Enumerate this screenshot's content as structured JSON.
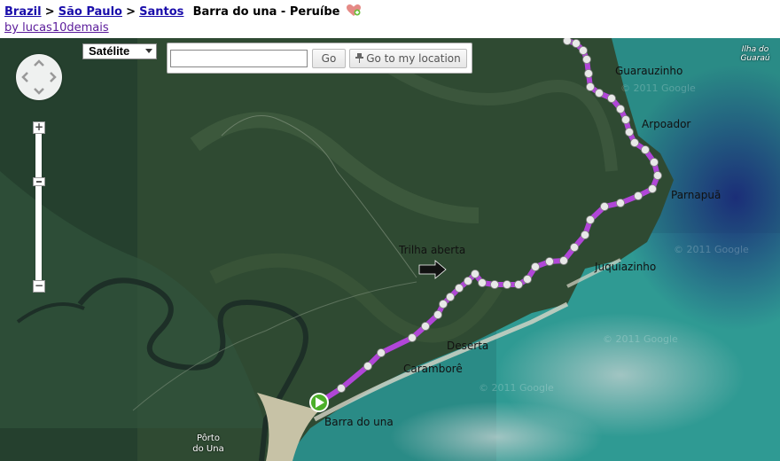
{
  "header": {
    "breadcrumbs": [
      "Brazil",
      "São Paulo",
      "Santos"
    ],
    "separator": ">",
    "title": "Barra do una - Peruíbe",
    "author_link": "by lucas10demais",
    "heart_icon": "heart-plus-icon"
  },
  "map": {
    "map_type": "Satélite",
    "search": {
      "value": "",
      "placeholder": ""
    },
    "go_label": "Go",
    "locate_label": "Go to my location",
    "controls": {
      "pan_icon": "pan-arrows-icon",
      "zoom_in": "+",
      "zoom_out": "−"
    },
    "labels": {
      "guarauzinho": "Guarauzinho",
      "arpoador": "Arpoador",
      "parnapua": "Parnapuã",
      "trilha": "Trilha aberta",
      "juquiazinho": "Juquiazinho",
      "deserta": "Deserta",
      "carambore": "Caramborê",
      "barra": "Barra do una",
      "porto_line1": "Pôrto",
      "porto_line2": "do Una",
      "ilha_line1": "Ilha do",
      "ilha_line2": "Guaraú"
    },
    "watermark": "© 2011 Google",
    "colors": {
      "route": "#b146d8",
      "waypoint": "#e8e8e8",
      "start_marker": "#4caf2a",
      "forest": "#2f4a32",
      "ocean": "#2a8b86"
    }
  }
}
